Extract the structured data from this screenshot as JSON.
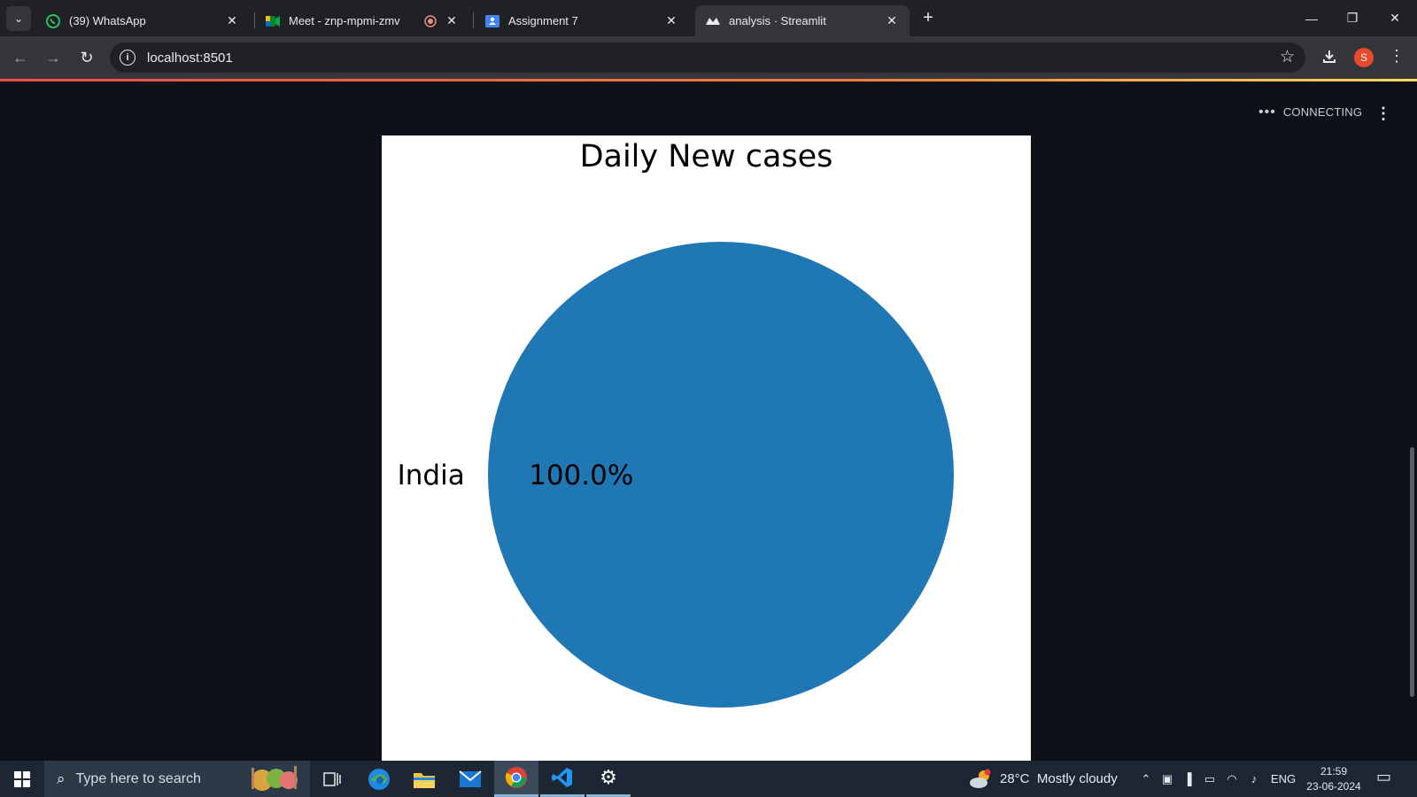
{
  "browser": {
    "tabs": [
      {
        "title": "(39) WhatsApp",
        "icon": "whatsapp-icon"
      },
      {
        "title": "Meet - znp-mpmi-zmv",
        "icon": "google-meet-icon"
      },
      {
        "title": "Assignment 7",
        "icon": "classroom-icon"
      },
      {
        "title": "analysis · Streamlit",
        "icon": "streamlit-icon",
        "active": true
      }
    ],
    "url": "localhost:8501",
    "profile_initial": "S"
  },
  "streamlit": {
    "status": "CONNECTING"
  },
  "chart_data": {
    "type": "pie",
    "title": "Daily New cases",
    "labels": [
      "India"
    ],
    "values": [
      100.0
    ],
    "autopct_labels": [
      "100.0%"
    ],
    "colors": [
      "#1f77b4"
    ]
  },
  "taskbar": {
    "search_placeholder": "Type here to search",
    "weather_text": "28°C  Mostly cloudy",
    "language": "ENG",
    "time": "21:59",
    "date": "23-06-2024"
  },
  "colors": {
    "page_bg": "#0e1117",
    "tabstrip_bg": "#202124",
    "toolbar_bg": "#35363a",
    "taskbar_bg": "#1c2733",
    "pie_blue": "#1f77b4"
  }
}
